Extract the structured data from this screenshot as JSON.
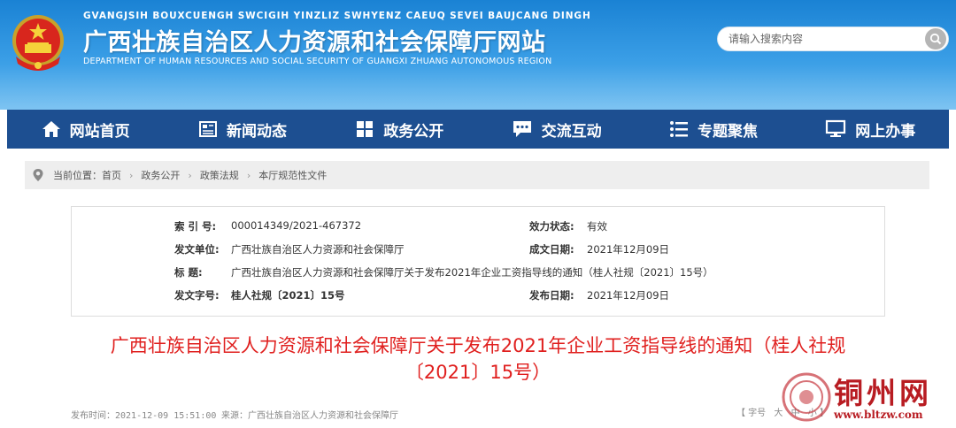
{
  "header": {
    "pinyin": "GVANGJSIH BOUXCUENGH SWCIGIH YINZLIZ SWHYENZ CAEUQ SEVEI BAUJCANG DINGH",
    "title": "广西壮族自治区人力资源和社会保障厅网站",
    "subtitle_en": "DEPARTMENT OF HUMAN RESOURCES AND SOCIAL SECURITY OF GUANGXI ZHUANG AUTONOMOUS REGION",
    "search_placeholder": "请输入搜索内容",
    "colors": {
      "header_top": "#1a82d4",
      "nav_bg": "#1d4f91",
      "title_red": "#e0201f"
    }
  },
  "nav": {
    "items": [
      {
        "label": "网站首页",
        "icon": "home-icon"
      },
      {
        "label": "新闻动态",
        "icon": "newspaper-icon"
      },
      {
        "label": "政务公开",
        "icon": "grid-icon"
      },
      {
        "label": "交流互动",
        "icon": "chat-icon"
      },
      {
        "label": "专题聚焦",
        "icon": "list-icon"
      },
      {
        "label": "网上办事",
        "icon": "monitor-icon"
      }
    ]
  },
  "breadcrumb": {
    "prefix": "当前位置：",
    "items": [
      "首页",
      "政务公开",
      "政策法规",
      "本厅规范性文件"
    ]
  },
  "info": {
    "index_label": "索  引 号:",
    "index_value": "000014349/2021-467372",
    "status_label": "效力状态:",
    "status_value": "有效",
    "issuer_label": "发文单位:",
    "issuer_value": "广西壮族自治区人力资源和社会保障厅",
    "created_label": "成文日期:",
    "created_value": "2021年12月09日",
    "title_label": "标      题:",
    "title_value": "广西壮族自治区人力资源和社会保障厅关于发布2021年企业工资指导线的通知（桂人社规〔2021〕15号）",
    "docno_label": "发文字号:",
    "docno_value": "桂人社规〔2021〕15号",
    "published_label": "发布日期:",
    "published_value": "2021年12月09日"
  },
  "article": {
    "title_line1": "广西壮族自治区人力资源和社会保障厅关于发布2021年企业工资指导线的通知（桂人社规",
    "title_line2": "〔2021〕15号）",
    "publish_time": "发布时间：2021-12-09 15:51:00",
    "source": "来源：广西壮族自治区人力资源和社会保障厅",
    "fontsize_label": "【 字号",
    "fontsize_large": "大",
    "fontsize_medium": "中",
    "fontsize_small": "小 】"
  },
  "watermark": {
    "text": "铜州网",
    "url": "www.bltzw.com"
  }
}
